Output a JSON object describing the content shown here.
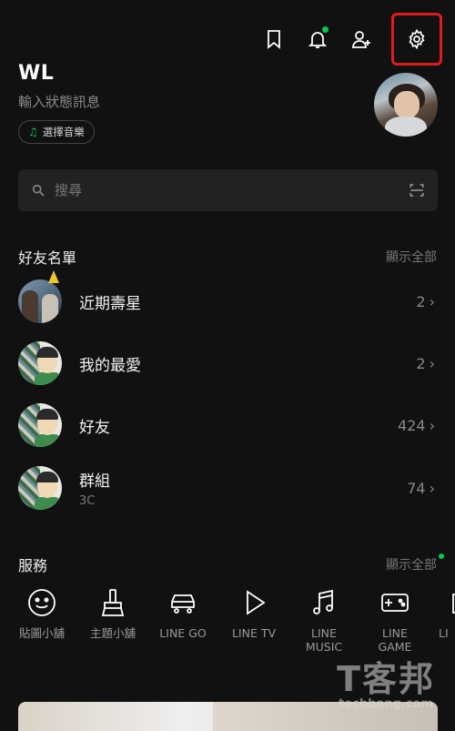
{
  "profile": {
    "name": "WL",
    "status": "輸入狀態訊息",
    "music_chip": "選擇音樂"
  },
  "search": {
    "placeholder": "搜尋"
  },
  "friends_section": {
    "title": "好友名單",
    "show_all": "顯示全部",
    "rows": [
      {
        "label": "近期壽星",
        "count": "2"
      },
      {
        "label": "我的最愛",
        "count": "2"
      },
      {
        "label": "好友",
        "count": "424"
      },
      {
        "label": "群組",
        "sub": "3C",
        "count": "74"
      }
    ]
  },
  "services_section": {
    "title": "服務",
    "show_all": "顯示全部",
    "items": [
      {
        "label": "貼圖小舖",
        "icon": "smiley-icon"
      },
      {
        "label": "主題小舖",
        "icon": "brush-icon"
      },
      {
        "label": "LINE GO",
        "icon": "car-icon"
      },
      {
        "label": "LINE TV",
        "icon": "play-icon"
      },
      {
        "label": "LINE\nMUSIC",
        "icon": "music-note-icon"
      },
      {
        "label": "LINE\nGAME",
        "icon": "gamepad-icon"
      },
      {
        "label": "LI",
        "icon": "partial-icon"
      }
    ]
  },
  "watermark": {
    "logo": "T客邦",
    "url": "techbang.com"
  },
  "colors": {
    "accent_green": "#06c755",
    "highlight_red": "#e01b1b",
    "background": "#111111"
  }
}
